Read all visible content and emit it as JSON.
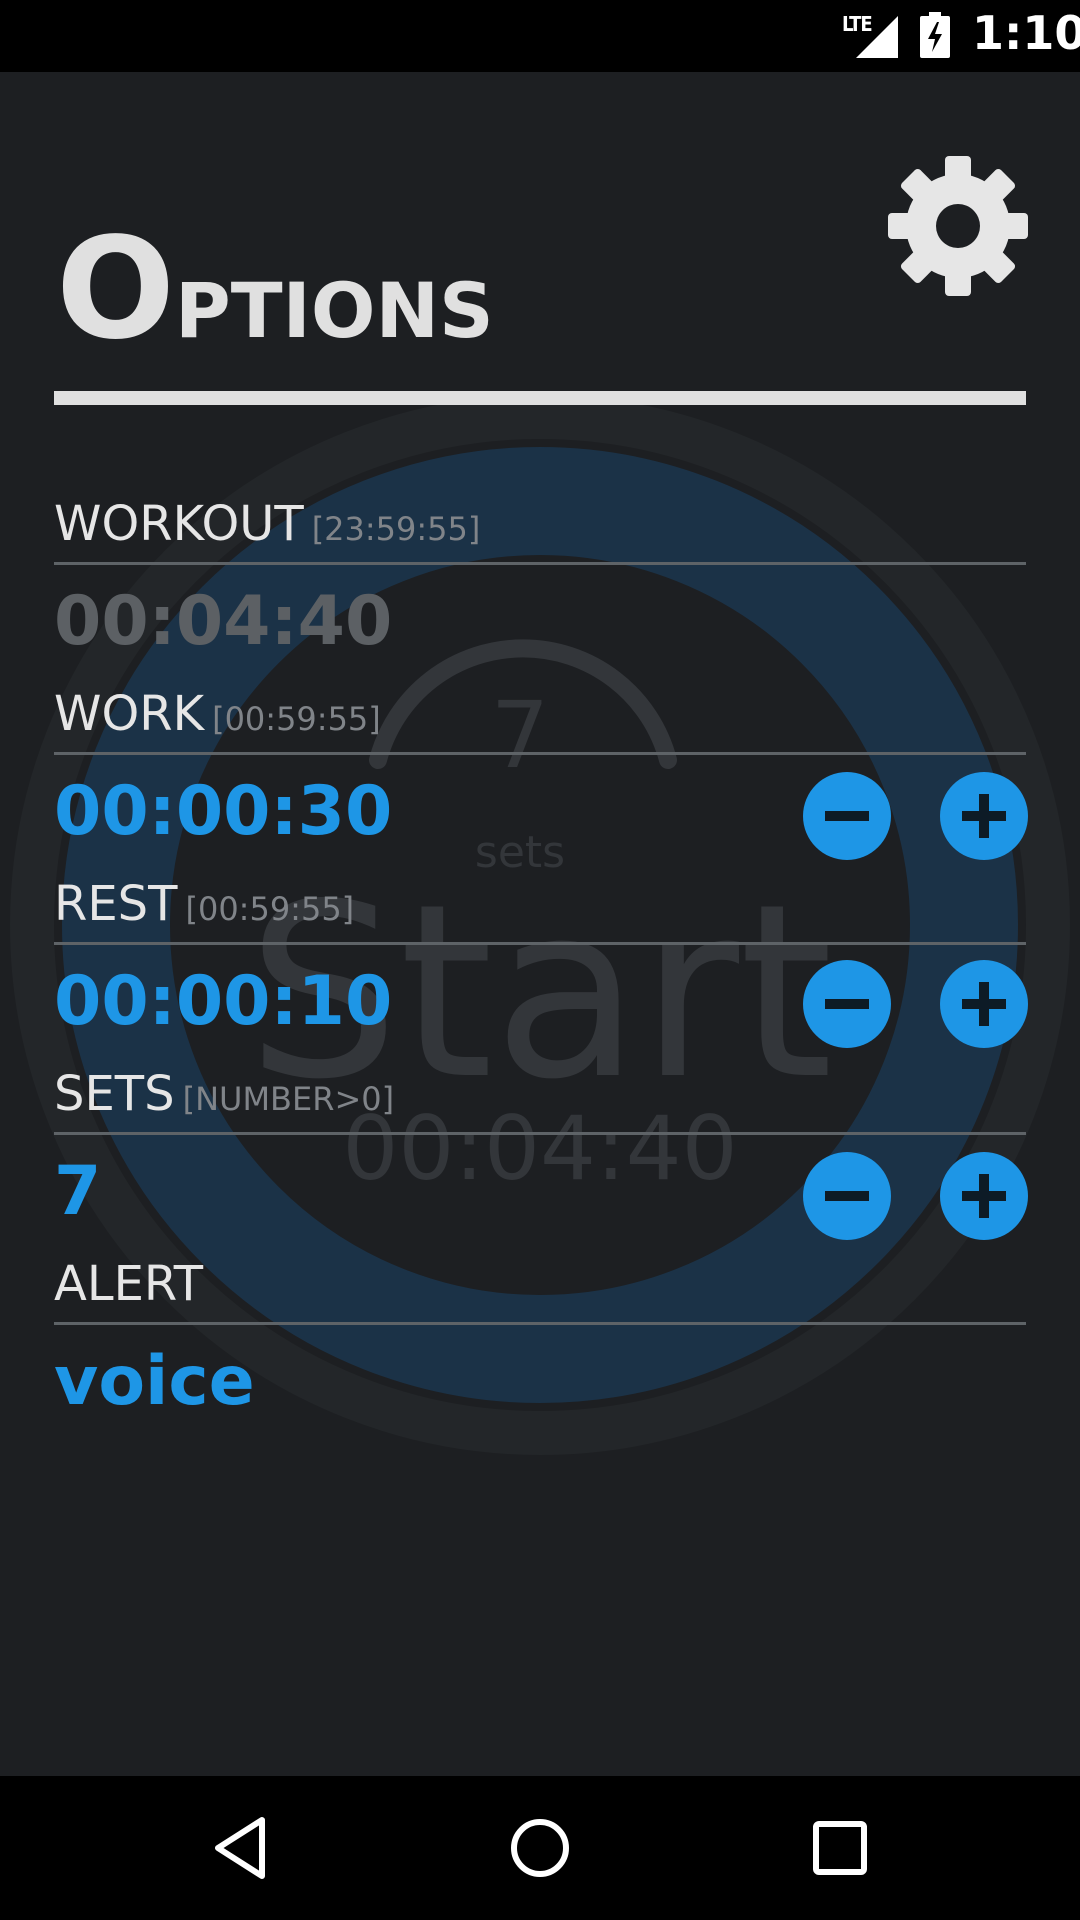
{
  "status_bar": {
    "network": "LTE",
    "time": "1:10"
  },
  "background_timer": {
    "sets_count": "7",
    "sets_label": "sets",
    "start_label": "Start",
    "total_time": "00:04:40"
  },
  "page": {
    "title_first": "O",
    "title_rest": "PTIONS",
    "settings_icon": "gear-icon"
  },
  "options": {
    "workout": {
      "label": "WORKOUT",
      "hint": "[23:59:55]",
      "value": "00:04:40"
    },
    "work": {
      "label": "WORK",
      "hint": "[00:59:55]",
      "value": "00:00:30"
    },
    "rest": {
      "label": "REST",
      "hint": "[00:59:55]",
      "value": "00:00:10"
    },
    "sets": {
      "label": "SETS",
      "hint": "[NUMBER>0]",
      "value": "7"
    },
    "alert": {
      "label": "ALERT",
      "value": "voice"
    }
  },
  "colors": {
    "accent": "#1e96e6",
    "background": "#1d1f22",
    "text": "#e6e6e6",
    "hint": "#808489"
  },
  "nav_bar": {
    "back_icon": "back-triangle-icon",
    "home_icon": "home-circle-icon",
    "recents_icon": "recents-square-icon"
  }
}
